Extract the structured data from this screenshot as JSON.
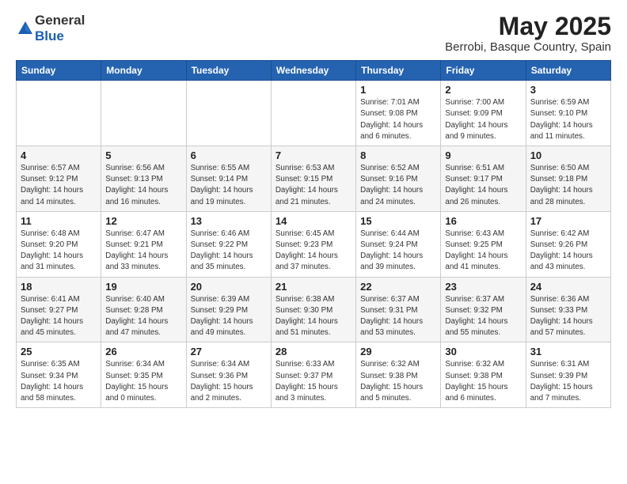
{
  "logo": {
    "general": "General",
    "blue": "Blue"
  },
  "title": "May 2025",
  "location": "Berrobi, Basque Country, Spain",
  "days_header": [
    "Sunday",
    "Monday",
    "Tuesday",
    "Wednesday",
    "Thursday",
    "Friday",
    "Saturday"
  ],
  "weeks": [
    [
      {
        "day": "",
        "info": ""
      },
      {
        "day": "",
        "info": ""
      },
      {
        "day": "",
        "info": ""
      },
      {
        "day": "",
        "info": ""
      },
      {
        "day": "1",
        "info": "Sunrise: 7:01 AM\nSunset: 9:08 PM\nDaylight: 14 hours\nand 6 minutes."
      },
      {
        "day": "2",
        "info": "Sunrise: 7:00 AM\nSunset: 9:09 PM\nDaylight: 14 hours\nand 9 minutes."
      },
      {
        "day": "3",
        "info": "Sunrise: 6:59 AM\nSunset: 9:10 PM\nDaylight: 14 hours\nand 11 minutes."
      }
    ],
    [
      {
        "day": "4",
        "info": "Sunrise: 6:57 AM\nSunset: 9:12 PM\nDaylight: 14 hours\nand 14 minutes."
      },
      {
        "day": "5",
        "info": "Sunrise: 6:56 AM\nSunset: 9:13 PM\nDaylight: 14 hours\nand 16 minutes."
      },
      {
        "day": "6",
        "info": "Sunrise: 6:55 AM\nSunset: 9:14 PM\nDaylight: 14 hours\nand 19 minutes."
      },
      {
        "day": "7",
        "info": "Sunrise: 6:53 AM\nSunset: 9:15 PM\nDaylight: 14 hours\nand 21 minutes."
      },
      {
        "day": "8",
        "info": "Sunrise: 6:52 AM\nSunset: 9:16 PM\nDaylight: 14 hours\nand 24 minutes."
      },
      {
        "day": "9",
        "info": "Sunrise: 6:51 AM\nSunset: 9:17 PM\nDaylight: 14 hours\nand 26 minutes."
      },
      {
        "day": "10",
        "info": "Sunrise: 6:50 AM\nSunset: 9:18 PM\nDaylight: 14 hours\nand 28 minutes."
      }
    ],
    [
      {
        "day": "11",
        "info": "Sunrise: 6:48 AM\nSunset: 9:20 PM\nDaylight: 14 hours\nand 31 minutes."
      },
      {
        "day": "12",
        "info": "Sunrise: 6:47 AM\nSunset: 9:21 PM\nDaylight: 14 hours\nand 33 minutes."
      },
      {
        "day": "13",
        "info": "Sunrise: 6:46 AM\nSunset: 9:22 PM\nDaylight: 14 hours\nand 35 minutes."
      },
      {
        "day": "14",
        "info": "Sunrise: 6:45 AM\nSunset: 9:23 PM\nDaylight: 14 hours\nand 37 minutes."
      },
      {
        "day": "15",
        "info": "Sunrise: 6:44 AM\nSunset: 9:24 PM\nDaylight: 14 hours\nand 39 minutes."
      },
      {
        "day": "16",
        "info": "Sunrise: 6:43 AM\nSunset: 9:25 PM\nDaylight: 14 hours\nand 41 minutes."
      },
      {
        "day": "17",
        "info": "Sunrise: 6:42 AM\nSunset: 9:26 PM\nDaylight: 14 hours\nand 43 minutes."
      }
    ],
    [
      {
        "day": "18",
        "info": "Sunrise: 6:41 AM\nSunset: 9:27 PM\nDaylight: 14 hours\nand 45 minutes."
      },
      {
        "day": "19",
        "info": "Sunrise: 6:40 AM\nSunset: 9:28 PM\nDaylight: 14 hours\nand 47 minutes."
      },
      {
        "day": "20",
        "info": "Sunrise: 6:39 AM\nSunset: 9:29 PM\nDaylight: 14 hours\nand 49 minutes."
      },
      {
        "day": "21",
        "info": "Sunrise: 6:38 AM\nSunset: 9:30 PM\nDaylight: 14 hours\nand 51 minutes."
      },
      {
        "day": "22",
        "info": "Sunrise: 6:37 AM\nSunset: 9:31 PM\nDaylight: 14 hours\nand 53 minutes."
      },
      {
        "day": "23",
        "info": "Sunrise: 6:37 AM\nSunset: 9:32 PM\nDaylight: 14 hours\nand 55 minutes."
      },
      {
        "day": "24",
        "info": "Sunrise: 6:36 AM\nSunset: 9:33 PM\nDaylight: 14 hours\nand 57 minutes."
      }
    ],
    [
      {
        "day": "25",
        "info": "Sunrise: 6:35 AM\nSunset: 9:34 PM\nDaylight: 14 hours\nand 58 minutes."
      },
      {
        "day": "26",
        "info": "Sunrise: 6:34 AM\nSunset: 9:35 PM\nDaylight: 15 hours\nand 0 minutes."
      },
      {
        "day": "27",
        "info": "Sunrise: 6:34 AM\nSunset: 9:36 PM\nDaylight: 15 hours\nand 2 minutes."
      },
      {
        "day": "28",
        "info": "Sunrise: 6:33 AM\nSunset: 9:37 PM\nDaylight: 15 hours\nand 3 minutes."
      },
      {
        "day": "29",
        "info": "Sunrise: 6:32 AM\nSunset: 9:38 PM\nDaylight: 15 hours\nand 5 minutes."
      },
      {
        "day": "30",
        "info": "Sunrise: 6:32 AM\nSunset: 9:38 PM\nDaylight: 15 hours\nand 6 minutes."
      },
      {
        "day": "31",
        "info": "Sunrise: 6:31 AM\nSunset: 9:39 PM\nDaylight: 15 hours\nand 7 minutes."
      }
    ]
  ]
}
